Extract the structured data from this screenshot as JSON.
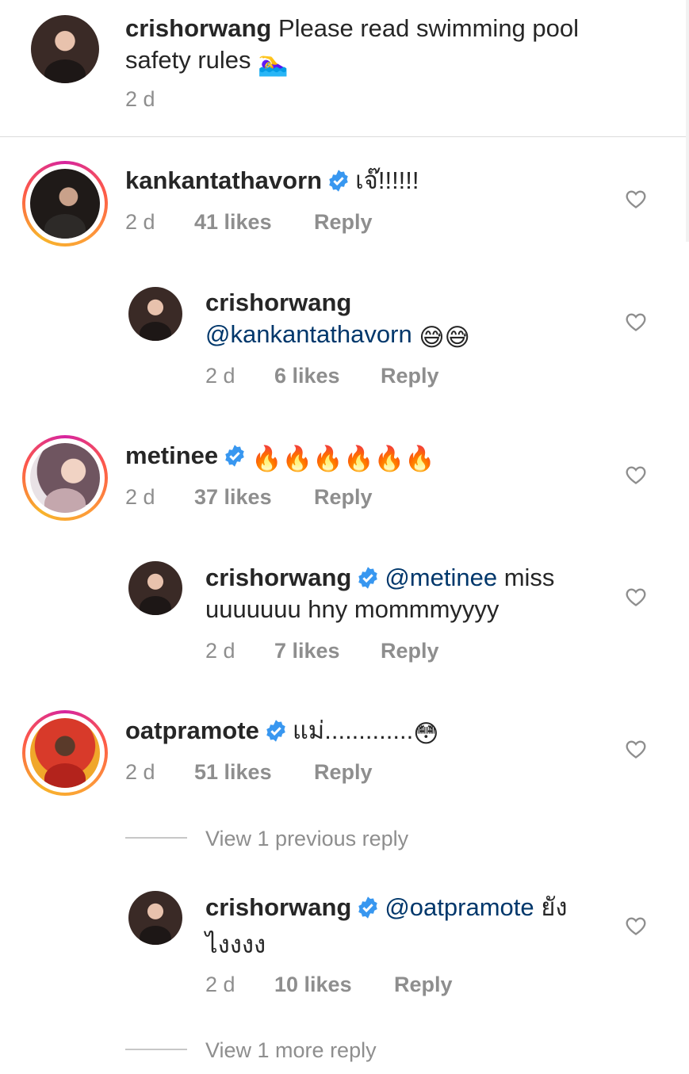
{
  "caption": {
    "username": "crishorwang",
    "text": "Please read swimming pool safety rules",
    "emoji": "🏊‍♀️",
    "time": "2 d"
  },
  "comments": [
    {
      "username": "kankantathavorn",
      "verified": true,
      "text": "เจ๊!!!!!!",
      "time": "2 d",
      "likes": "41 likes",
      "reply": "Reply"
    },
    {
      "username": "crishorwang",
      "verified": false,
      "mention": "@kankantathavorn",
      "emojis": "😅😅",
      "time": "2 d",
      "likes": "6 likes",
      "reply": "Reply"
    },
    {
      "username": "metinee",
      "verified": true,
      "emojis": "🔥🔥🔥🔥🔥🔥",
      "time": "2 d",
      "likes": "37 likes",
      "reply": "Reply"
    },
    {
      "username": "crishorwang",
      "verified": true,
      "mention": "@metinee",
      "text_a": "miss",
      "text_b": "uuuuuuu hny mommmyyyy",
      "time": "2 d",
      "likes": "7 likes",
      "reply": "Reply"
    },
    {
      "username": "oatpramote",
      "verified": true,
      "text": "แม่.............",
      "emoji": "😳",
      "time": "2 d",
      "likes": "51 likes",
      "reply": "Reply"
    },
    {
      "username": "crishorwang",
      "verified": true,
      "mention": "@oatpramote",
      "text_a": "ยัง",
      "text_b": "ไงงงง",
      "time": "2 d",
      "likes": "10 likes",
      "reply": "Reply"
    }
  ],
  "view_previous": "View 1 previous reply",
  "view_more": "View 1 more reply",
  "colors": {
    "verified": "#3897f0",
    "mention": "#00376b",
    "meta": "#8e8e8e"
  },
  "icons": [
    "heart-icon",
    "verified-badge-icon"
  ]
}
